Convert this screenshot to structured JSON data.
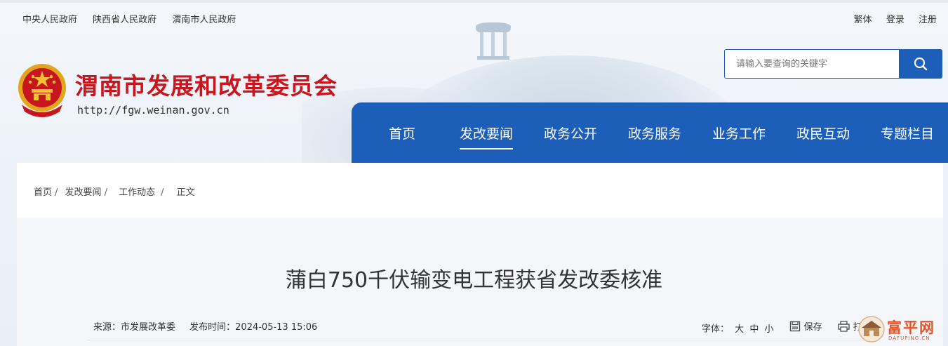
{
  "top_links": {
    "central": "中央人民政府",
    "shaanxi": "陕西省人民政府",
    "weinan": "渭南市人民政府"
  },
  "user_links": {
    "traditional": "繁体",
    "login": "登录",
    "register": "注册"
  },
  "site": {
    "title": "渭南市发展和改革委员会",
    "url": "http://fgw.weinan.gov.cn"
  },
  "search": {
    "placeholder": "请输入要查询的关键字"
  },
  "nav": {
    "items": [
      {
        "label": "首页"
      },
      {
        "label": "发改要闻",
        "active": true
      },
      {
        "label": "政务公开"
      },
      {
        "label": "政务服务"
      },
      {
        "label": "业务工作"
      },
      {
        "label": "政民互动"
      },
      {
        "label": "专题栏目"
      }
    ]
  },
  "breadcrumb": [
    "首页",
    "发改要闻",
    "工作动态",
    "正文"
  ],
  "article": {
    "title": "蒲白750千伏输变电工程获省发改委核准",
    "source": "来源：市发展改革委",
    "published": "发布时间：2024-05-13 15:06"
  },
  "tools": {
    "font_label": "字体：",
    "large": "大",
    "medium": "中",
    "small": "小",
    "save": "保存",
    "print": "打印"
  },
  "watermark": {
    "text": "富平网",
    "sub": "DAFUPING.CN"
  },
  "colors": {
    "brand_blue": "#1d5fb8",
    "title_red": "#c8161e"
  }
}
